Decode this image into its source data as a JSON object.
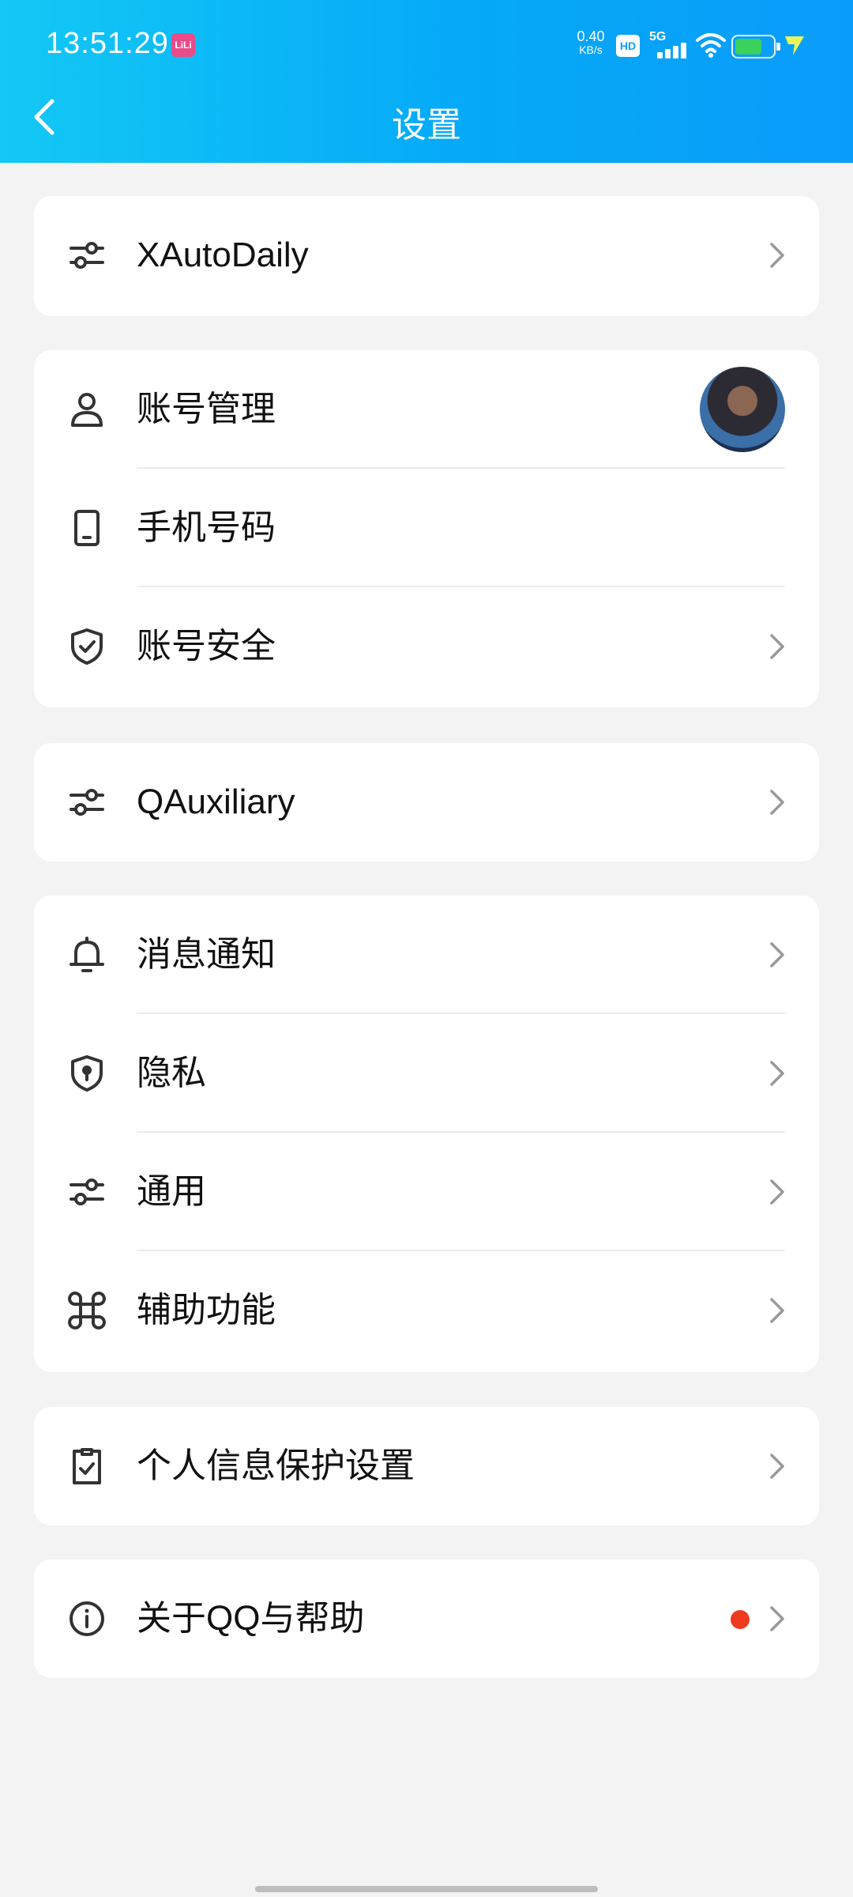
{
  "status_bar": {
    "time": "13:51:29",
    "app_badge": "LiLi",
    "net_speed_value": "0.40",
    "net_speed_unit": "KB/s",
    "hd_label": "HD",
    "network_type": "5G"
  },
  "header": {
    "title": "设置"
  },
  "groups": [
    {
      "items": [
        {
          "label": "XAutoDaily",
          "icon": "sliders-icon",
          "chevron": true
        }
      ]
    },
    {
      "items": [
        {
          "label": "账号管理",
          "icon": "person-icon",
          "avatar": true
        },
        {
          "label": "手机号码",
          "icon": "phone-icon",
          "chevron": false
        },
        {
          "label": "账号安全",
          "icon": "shield-check-icon",
          "chevron": true
        }
      ]
    },
    {
      "items": [
        {
          "label": "QAuxiliary",
          "icon": "sliders-icon",
          "chevron": true
        }
      ]
    },
    {
      "items": [
        {
          "label": "消息通知",
          "icon": "bell-icon",
          "chevron": true
        },
        {
          "label": "隐私",
          "icon": "shield-lock-icon",
          "chevron": true
        },
        {
          "label": "通用",
          "icon": "sliders-icon",
          "chevron": true
        },
        {
          "label": "辅助功能",
          "icon": "command-icon",
          "chevron": true
        }
      ]
    },
    {
      "items": [
        {
          "label": "个人信息保护设置",
          "icon": "clipboard-check-icon",
          "chevron": true
        }
      ]
    },
    {
      "items": [
        {
          "label": "关于QQ与帮助",
          "icon": "info-icon",
          "chevron": true,
          "badge_dot": true
        }
      ]
    }
  ],
  "colors": {
    "header_gradient_start": "#13c8f5",
    "header_gradient_end": "#0a9cf9",
    "background": "#f3f3f3",
    "red_dot": "#ef3a20"
  }
}
